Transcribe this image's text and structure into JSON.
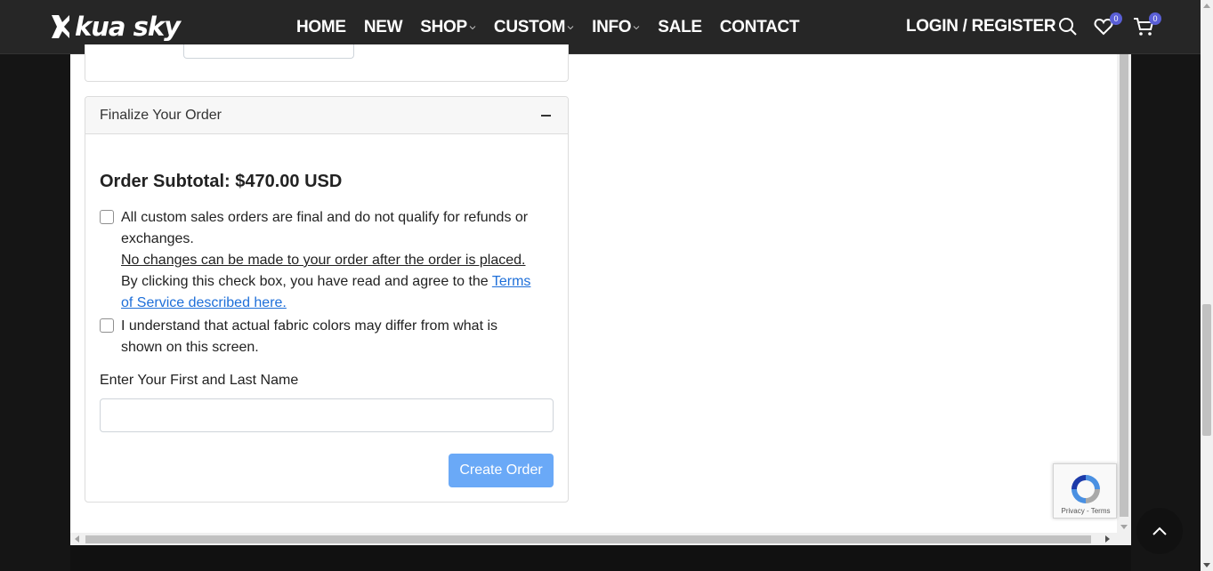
{
  "header": {
    "logo_text": "kua sky",
    "nav": [
      {
        "label": "HOME",
        "dropdown": false
      },
      {
        "label": "NEW",
        "dropdown": false
      },
      {
        "label": "SHOP",
        "dropdown": true
      },
      {
        "label": "CUSTOM",
        "dropdown": true
      },
      {
        "label": "INFO",
        "dropdown": true
      },
      {
        "label": "SALE",
        "dropdown": false
      },
      {
        "label": "CONTACT",
        "dropdown": false
      }
    ],
    "login_label": "LOGIN / REGISTER",
    "wishlist_count": "0",
    "cart_count": "0"
  },
  "finalize": {
    "title": "Finalize Your Order",
    "subtotal": "Order Subtotal: $470.00 USD",
    "terms_text_1": "All custom sales orders are final and do not qualify for refunds or exchanges.",
    "terms_text_2": "No changes can be made to your order after the order is placed.",
    "terms_text_3": "By clicking this check box, you have read and agree to the ",
    "terms_link": "Terms of Service described here.",
    "fabric_text": "I understand that actual fabric colors may differ from what is shown on this screen.",
    "name_label": "Enter Your First and Last Name",
    "name_value": "",
    "create_button": "Create Order"
  },
  "recaptcha": {
    "privacy": "Privacy",
    "separator": " - ",
    "terms": "Terms"
  },
  "colors": {
    "header_bg": "#262626",
    "button_primary": "#6aa9f7",
    "link": "#1e6fd9",
    "badge": "#5a5fd6"
  }
}
